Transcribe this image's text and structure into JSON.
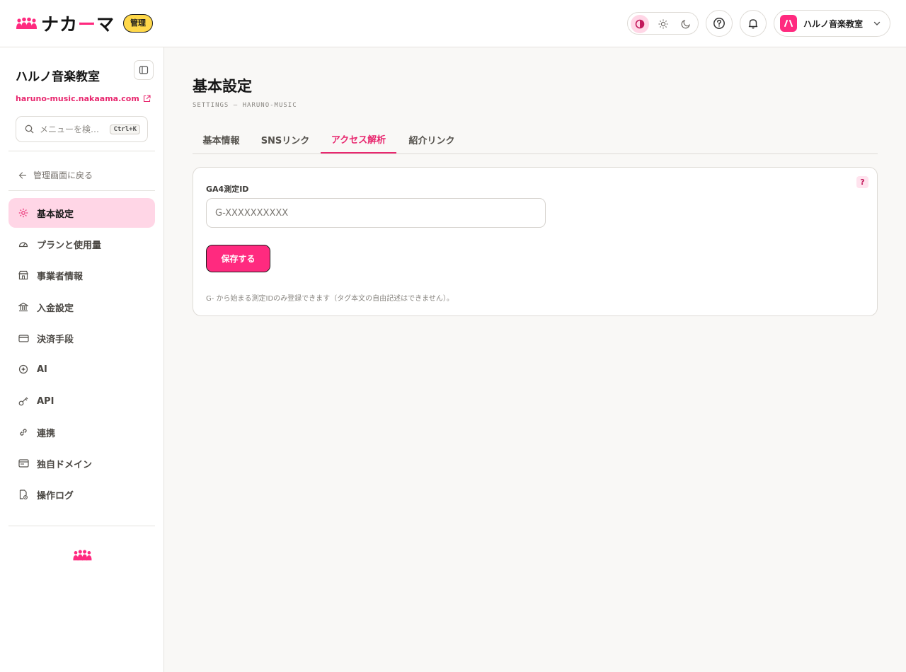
{
  "header": {
    "brand_prefix": "ナカ",
    "brand_accent": "ー",
    "brand_suffix": "マ",
    "admin_badge": "管理",
    "account_initial": "ハ",
    "account_name": "ハルノ音楽教室",
    "theme_modes": [
      "contrast-icon",
      "sun-icon",
      "moon-icon"
    ],
    "accent_color": "#ff2a7f",
    "badge_color": "#ffd84a"
  },
  "sidebar": {
    "org_name": "ハルノ音楽教室",
    "org_url": "haruno-music.nakaama.com",
    "search_placeholder": "メニューを検…",
    "search_shortcut": "Ctrl+K",
    "back_label": "管理画面に戻る",
    "items": [
      {
        "label": "基本設定",
        "icon": "gear-icon",
        "active": true
      },
      {
        "label": "プランと使用量",
        "icon": "gauge-icon",
        "active": false
      },
      {
        "label": "事業者情報",
        "icon": "store-icon",
        "active": false
      },
      {
        "label": "入金設定",
        "icon": "bank-icon",
        "active": false
      },
      {
        "label": "決済手段",
        "icon": "credit-card-icon",
        "active": false
      },
      {
        "label": "AI",
        "icon": "ai-icon",
        "active": false
      },
      {
        "label": "API",
        "icon": "key-icon",
        "active": false
      },
      {
        "label": "連携",
        "icon": "link-icon",
        "active": false
      },
      {
        "label": "独自ドメイン",
        "icon": "browser-icon",
        "active": false
      },
      {
        "label": "操作ログ",
        "icon": "log-file-icon",
        "active": false
      }
    ]
  },
  "main": {
    "title": "基本設定",
    "subtitle": "SETTINGS — HARUNO-MUSIC",
    "tabs": [
      {
        "label": "基本情報",
        "active": false
      },
      {
        "label": "SNSリンク",
        "active": false
      },
      {
        "label": "アクセス解析",
        "active": true
      },
      {
        "label": "紹介リンク",
        "active": false
      }
    ],
    "form": {
      "field_label": "GA4測定ID",
      "input_value": "",
      "input_placeholder": "G-XXXXXXXXXX",
      "help_label": "?",
      "save_label": "保存する",
      "hint": "G- から始まる測定IDのみ登録できます（タグ本文の自由記述はできません）。"
    }
  }
}
